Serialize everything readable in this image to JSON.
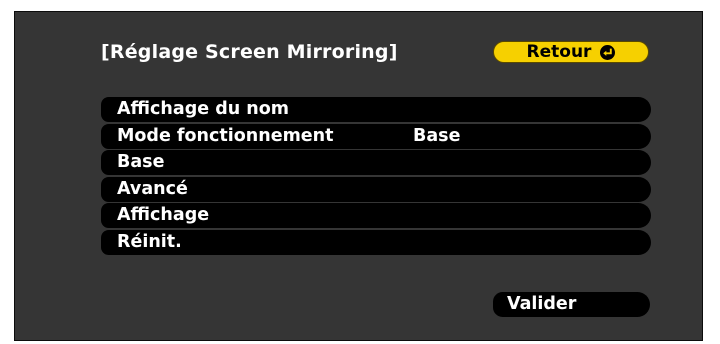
{
  "dialog": {
    "title": "[Réglage Screen Mirroring]",
    "return_label": "Retour",
    "return_icon": "enter-key-icon",
    "validate_label": "Valider"
  },
  "menu": {
    "items": [
      {
        "label": "Affichage du nom",
        "value": ""
      },
      {
        "label": "Mode fonctionnement",
        "value": "Base"
      },
      {
        "label": "Base",
        "value": ""
      },
      {
        "label": "Avancé",
        "value": ""
      },
      {
        "label": "Affichage",
        "value": ""
      },
      {
        "label": "Réinit.",
        "value": ""
      }
    ]
  },
  "colors": {
    "panel_background": "#353535",
    "item_background": "#000000",
    "selected_button": "#f6d000",
    "text": "#ffffff"
  }
}
